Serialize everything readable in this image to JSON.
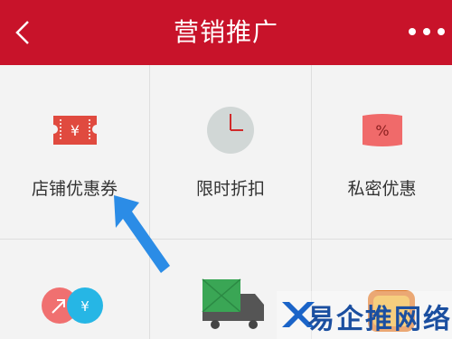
{
  "header": {
    "title": "营销推广",
    "background": "#c8132a"
  },
  "grid": {
    "items": [
      {
        "label": "店铺优惠券",
        "icon": "coupon-icon",
        "glyph": "¥"
      },
      {
        "label": "限时折扣",
        "icon": "clock-icon"
      },
      {
        "label": "私密优惠",
        "icon": "percent-tag-icon",
        "glyph": "%"
      },
      {
        "label": "",
        "icon": "share-yuan-icon",
        "glyph": "¥"
      },
      {
        "label": "",
        "icon": "delivery-truck-icon"
      },
      {
        "label": "",
        "icon": "promo-badge-icon"
      }
    ]
  },
  "watermark": {
    "text": "易企推网络"
  },
  "colors": {
    "accent": "#c8132a",
    "coupon": "#e04a3f",
    "pointer_arrow": "#2b8ce6",
    "share_left": "#f07070",
    "share_right": "#26b6e5",
    "truck_box": "#3aa655"
  }
}
